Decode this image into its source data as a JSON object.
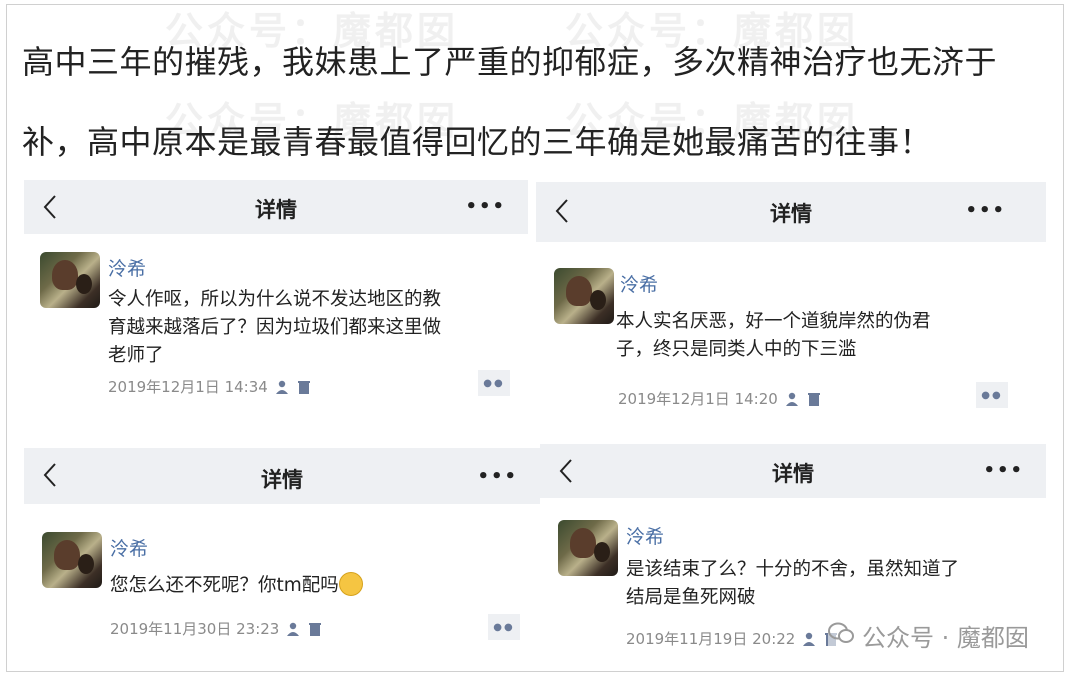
{
  "caption": {
    "line1": "高中三年的摧残，我妹患上了严重的抑郁症，多次精神治疗也无济于",
    "line2": "补，高中原本是最青春最值得回忆的三年确是她最痛苦的往事！"
  },
  "watermark": "公众号：魔都囡",
  "brand": {
    "label": "公众号 · 魔都囡",
    "icon": "wechat-icon"
  },
  "panels": [
    {
      "title": "详情",
      "username": "泠希",
      "message_lines": [
        "令人作呕，所以为什么说不发达地区的教",
        "育越来越落后了？因为垃圾们都来这里做",
        "老师了"
      ],
      "timestamp": "2019年12月1日 14:34"
    },
    {
      "title": "详情",
      "username": "泠希",
      "message_lines": [
        "本人实名厌恶，好一个道貌岸然的伪君",
        "子，终只是同类人中的下三滥"
      ],
      "timestamp": "2019年12月1日 14:20"
    },
    {
      "title": "详情",
      "username": "泠希",
      "message_lines": [
        "您怎么还不死呢？你tm配吗"
      ],
      "timestamp": "2019年11月30日 23:23"
    },
    {
      "title": "详情",
      "username": "泠希",
      "message_lines": [
        "是该结束了么？十分的不舍，虽然知道了",
        "结局是鱼死网破"
      ],
      "timestamp": "2019年11月19日 20:22"
    }
  ],
  "colors": {
    "header_bg": "#eef0f3",
    "username": "#4a6fa5",
    "meta": "#8a8a8a"
  }
}
